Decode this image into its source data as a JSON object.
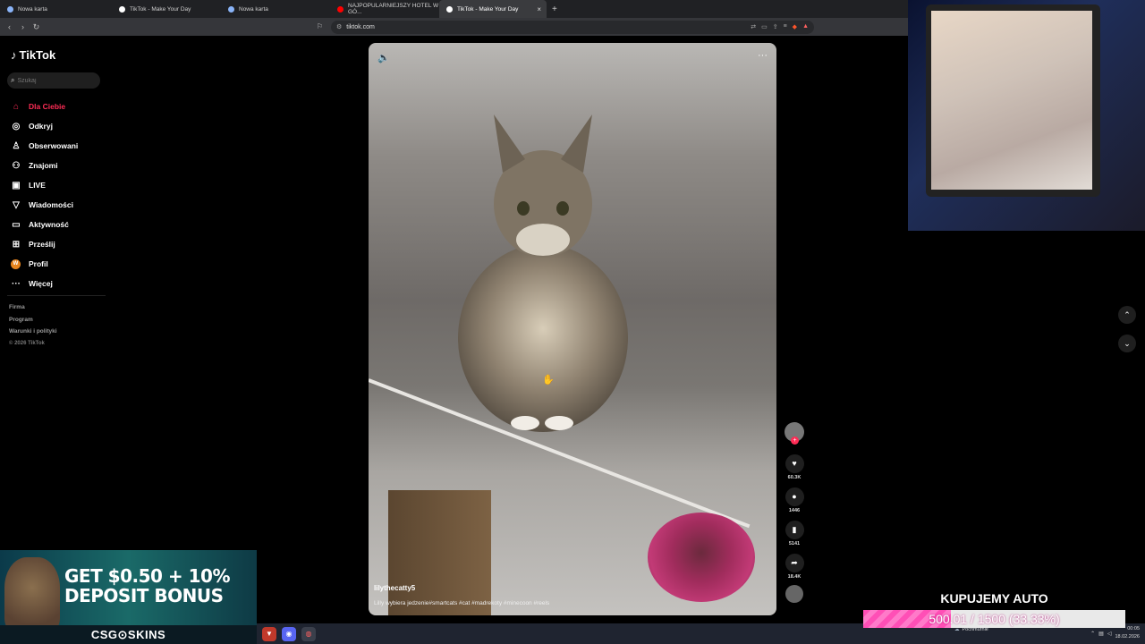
{
  "browser": {
    "tabs": [
      {
        "label": "Nowa karta",
        "active": false,
        "icon_color": "#8ab4f8"
      },
      {
        "label": "TikTok - Make Your Day",
        "active": false,
        "icon_color": "#ffffff"
      },
      {
        "label": "Nowa karta",
        "active": false,
        "icon_color": "#8ab4f8"
      },
      {
        "label": "NAJPOPULARNIEJSZY HOTEL W GÓ...",
        "active": false,
        "icon_color": "#ff0000"
      },
      {
        "label": "TikTok - Make Your Day",
        "active": true,
        "icon_color": "#ffffff"
      }
    ],
    "close_glyph": "×",
    "new_tab_glyph": "+",
    "url": "tiktok.com"
  },
  "sidebar": {
    "logo": "TikTok",
    "search_placeholder": "Szukaj",
    "items": [
      {
        "label": "Dla Ciebie",
        "icon": "home-icon",
        "glyph": "⌂",
        "active": true
      },
      {
        "label": "Odkryj",
        "icon": "compass-icon",
        "glyph": "◎",
        "active": false
      },
      {
        "label": "Obserwowani",
        "icon": "user-follow-icon",
        "glyph": "♙",
        "active": false
      },
      {
        "label": "Znajomi",
        "icon": "friends-icon",
        "glyph": "⚇",
        "active": false
      },
      {
        "label": "LIVE",
        "icon": "live-icon",
        "glyph": "▣",
        "active": false
      },
      {
        "label": "Wiadomości",
        "icon": "messages-icon",
        "glyph": "▽",
        "active": false
      },
      {
        "label": "Aktywność",
        "icon": "activity-icon",
        "glyph": "▭",
        "active": false
      },
      {
        "label": "Prześlij",
        "icon": "upload-icon",
        "glyph": "⊞",
        "active": false
      },
      {
        "label": "Profil",
        "icon": "profile-avatar",
        "glyph": "W",
        "active": false
      },
      {
        "label": "Więcej",
        "icon": "more-icon",
        "glyph": "···",
        "active": false
      }
    ],
    "footer": [
      "Firma",
      "Program",
      "Warunki i polityki"
    ],
    "copyright": "© 2026 TikTok"
  },
  "video": {
    "author": "lilythecatty5",
    "caption": "Lilly wybiera jedzenie#smartcats #cat #madrekoty #minecoon #reels",
    "likes": "60.3K",
    "comments": "1446",
    "saves": "5141",
    "shares": "18.4K"
  },
  "ad": {
    "headline_1": "GET $0.50 + 10%",
    "headline_2": "DEPOSIT BONUS",
    "brand": "CSG⊙SKINS"
  },
  "goal": {
    "title": "KUPUJEMY AUTO",
    "progress_text": "500.01 / 1500 (33.33%)",
    "progress": 0.3333
  },
  "taskbar": {
    "weather": "Pochmurnie",
    "time": "00:05",
    "date": "18.02.2026"
  },
  "colors": {
    "accent": "#fe2c55",
    "goal_pink": "#ff4fb6"
  }
}
